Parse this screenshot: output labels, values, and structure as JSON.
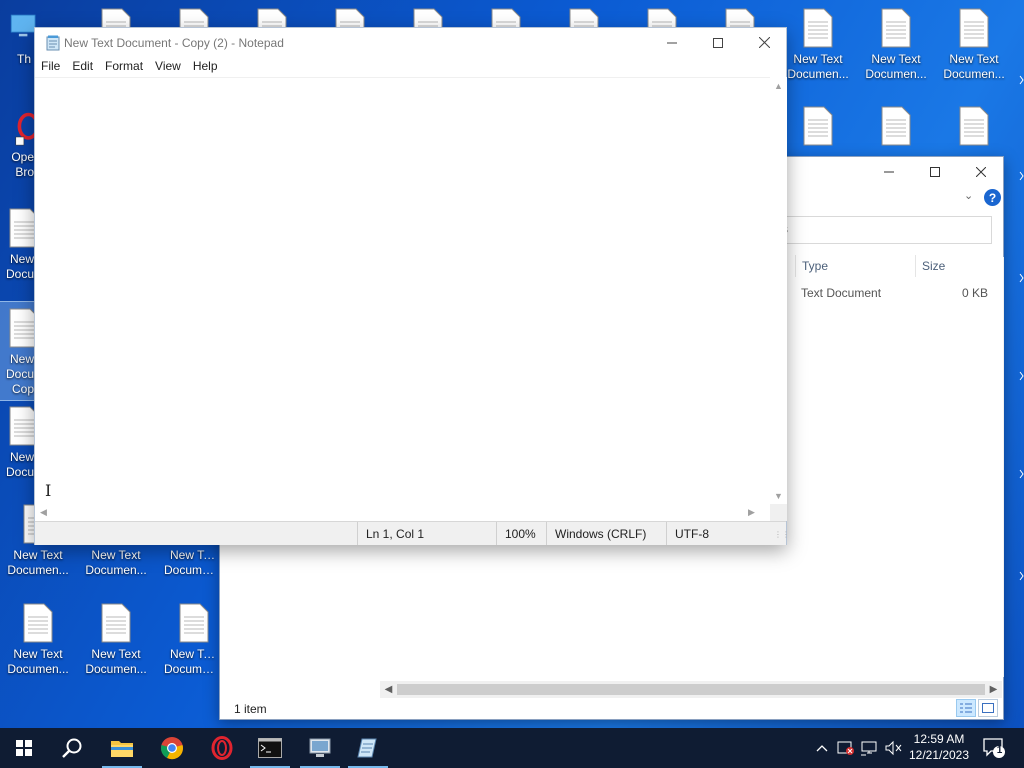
{
  "desktop": {
    "top_partial_labels": [
      "Th"
    ],
    "left_column": [
      {
        "line1": "Ope",
        "line2": "Bro"
      },
      {
        "line1": "New",
        "line2": "Docu"
      },
      {
        "line1": "New",
        "line2": "Docu",
        "line3": "Cop"
      },
      {
        "line1": "New",
        "line2": "Docu"
      }
    ],
    "icon_line1": "New Text",
    "icon_line2": "Documen..."
  },
  "explorer": {
    "search_partial": "s",
    "columns": {
      "type": "Type",
      "size": "Size"
    },
    "rows": [
      {
        "type": "Text Document",
        "size": "0 KB"
      }
    ],
    "status": "1 item",
    "help_label": "?"
  },
  "notepad": {
    "title": "New Text Document - Copy (2) - Notepad",
    "menu": [
      "File",
      "Edit",
      "Format",
      "View",
      "Help"
    ],
    "content": "",
    "status": {
      "position": "Ln 1, Col 1",
      "zoom": "100%",
      "line_endings": "Windows (CRLF)",
      "encoding": "UTF-8"
    }
  },
  "taskbar": {
    "clock_time": "12:59 AM",
    "clock_date": "12/21/2023",
    "notification_count": "1",
    "pinned": [
      "start",
      "search",
      "file-explorer",
      "chrome",
      "opera",
      "terminal",
      "remote-desktop",
      "notepad"
    ]
  },
  "colors": {
    "desktop_bg": "#0b5bd3",
    "taskbar_bg": "#0f1c33",
    "accent": "#1a66d0"
  }
}
